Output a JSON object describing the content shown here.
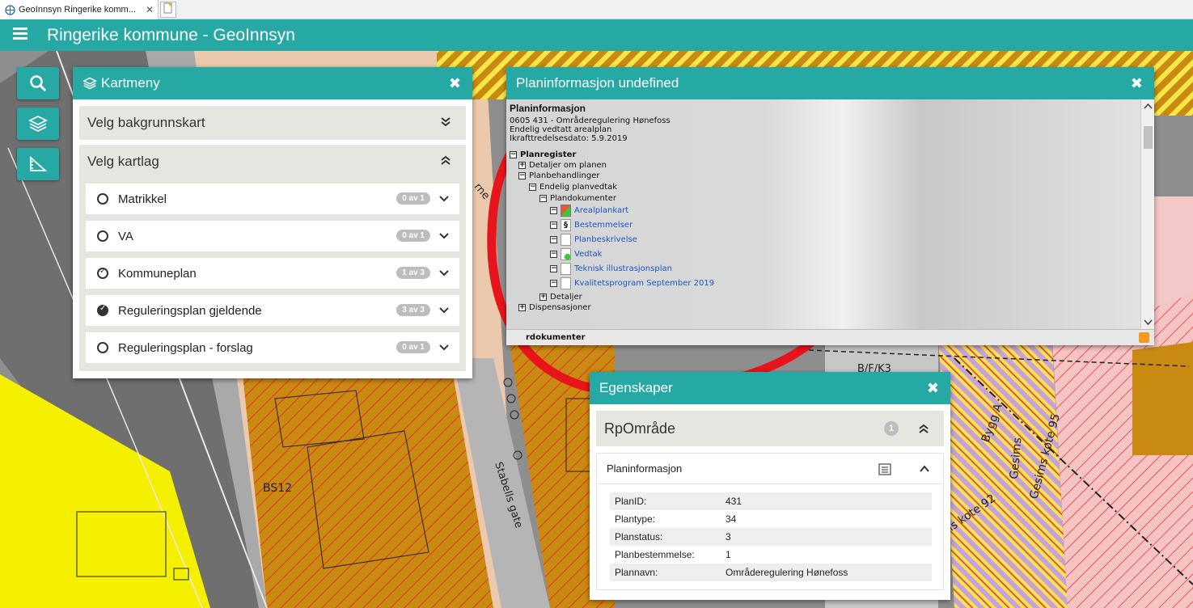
{
  "browser": {
    "tab_title": "GeoInnsyn Ringerike komm...",
    "tab_close": "✕"
  },
  "app": {
    "title": "Ringerike kommune - GeoInnsyn"
  },
  "map_labels": {
    "street": "Stabells gate",
    "street_partial": "rne",
    "bs12": "BS12",
    "bfk3": "B/F/K3",
    "bygg_a": "Bygg A",
    "kote95": "Gesims kote 95",
    "kote92": "ms kote 92",
    "gesims2": "Gesims"
  },
  "kartmeny": {
    "title": "Kartmeny",
    "close": "✖",
    "bakgrunn_label": "Velg bakgrunnskart",
    "kartlag_label": "Velg kartlag",
    "layers": [
      {
        "label": "Matrikkel",
        "count": "0 av 1",
        "state": "none"
      },
      {
        "label": "VA",
        "count": "0 av 1",
        "state": "none"
      },
      {
        "label": "Kommuneplan",
        "count": "1 av 3",
        "state": "part"
      },
      {
        "label": "Reguleringsplan gjeldende",
        "count": "3 av 3",
        "state": "full"
      },
      {
        "label": "Reguleringsplan - forslag",
        "count": "0 av 1",
        "state": "none"
      }
    ]
  },
  "planinfo": {
    "title": "Planinformasjon undefined",
    "close": "✖",
    "heading": "Planinformasjon",
    "line1": "0605 431 - Områderegulering Hønefoss",
    "line2": "Endelig vedtatt arealplan",
    "line3": "Ikrafttredelsesdato: 5.9.2019",
    "tree": {
      "planregister": "Planregister",
      "detaljer_om_planen": "Detaljer om planen",
      "planbehandlinger": "Planbehandlinger",
      "endelig_planvedtak": "Endelig planvedtak",
      "plandokumenter": "Plandokumenter",
      "docs": [
        "Arealplankart",
        "Bestemmelser",
        "Planbeskrivelse",
        "Vedtak",
        "Teknisk illustrasjonsplan",
        "Kvalitetsprogram September 2019"
      ],
      "detaljer": "Detaljer",
      "dispensasjoner": "Dispensasjoner"
    },
    "footer": "rdokumenter"
  },
  "egenskaper": {
    "title": "Egenskaper",
    "close": "✖",
    "subtitle": "RpOmråde",
    "count": "1",
    "section": "Planinformasjon",
    "props": [
      {
        "key": "PlanID:",
        "value": "431"
      },
      {
        "key": "Plantype:",
        "value": "34"
      },
      {
        "key": "Planstatus:",
        "value": "3"
      },
      {
        "key": "Planbestemmelse:",
        "value": "1"
      },
      {
        "key": "Plannavn:",
        "value": "Områderegulering Hønefoss"
      }
    ]
  },
  "colors": {
    "teal": "#26a9a4",
    "annotation_red": "#e8141b"
  }
}
